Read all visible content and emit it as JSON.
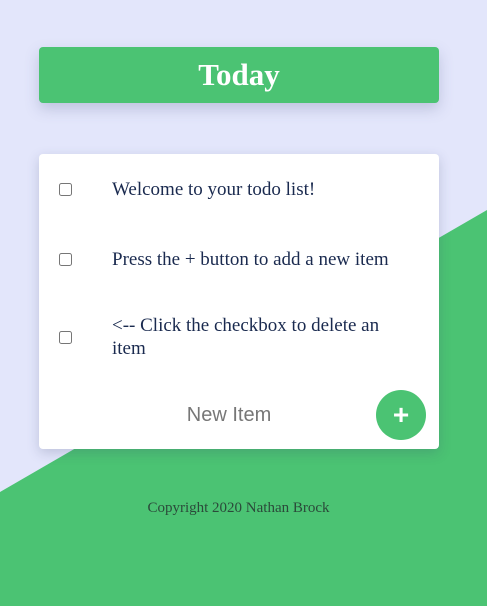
{
  "header": {
    "title": "Today"
  },
  "todos": {
    "items": [
      {
        "text": "Welcome to your todo list!"
      },
      {
        "text": "Press the + button to add a new item"
      },
      {
        "text": "<-- Click the checkbox to delete an item"
      }
    ],
    "new_item_placeholder": "New Item",
    "add_button_label": "+"
  },
  "footer": {
    "copyright": "Copyright 2020 Nathan Brock"
  },
  "colors": {
    "accent_green": "#4bc373",
    "background_lavender": "#e3e6fb",
    "text_navy": "#1a2a4f"
  }
}
